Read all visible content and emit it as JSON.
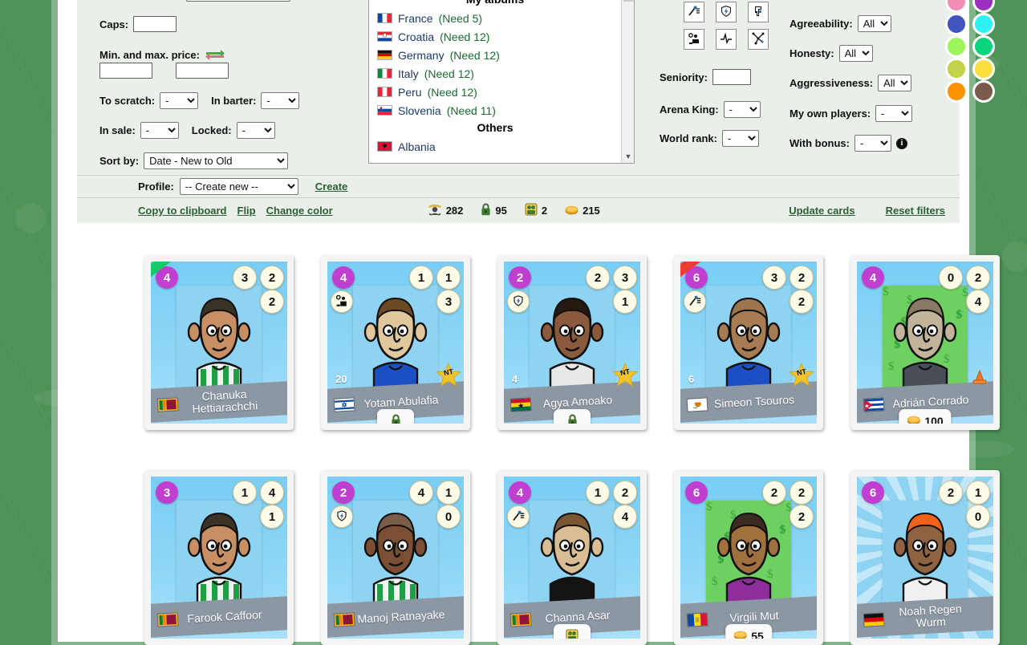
{
  "filters": {
    "caps_label": "Caps:",
    "caps_value": "",
    "price_label": "Min. and max. price:",
    "price_min": "",
    "price_max": "",
    "to_scratch_label": "To scratch:",
    "to_scratch_value": "-",
    "in_barter_label": "In barter:",
    "in_barter_value": "-",
    "in_sale_label": "In sale:",
    "in_sale_value": "-",
    "locked_label": "Locked:",
    "locked_value": "-",
    "sort_by_label": "Sort by:",
    "sort_by_value": "Date - New to Old",
    "seniority_label": "Seniority:",
    "seniority_value": "",
    "arena_king_label": "Arena King:",
    "arena_king_value": "-",
    "world_rank_label": "World rank:",
    "world_rank_value": "-",
    "agreeability_label": "Agreeability:",
    "agreeability_value": "All",
    "honesty_label": "Honesty:",
    "honesty_value": "All",
    "aggressiveness_label": "Aggressiveness:",
    "aggressiveness_value": "All",
    "my_own_players_label": "My own players:",
    "my_own_players_value": "-",
    "with_bonus_label": "With bonus:",
    "with_bonus_value": "-",
    "info_glyph": "i"
  },
  "skill_buttons": [
    {
      "name": "shooting-icon"
    },
    {
      "name": "shield-lightning-icon"
    },
    {
      "name": "goalkeeper-glove-icon"
    },
    {
      "name": "defender-icon"
    },
    {
      "name": "stamina-pulse-icon"
    },
    {
      "name": "passing-network-icon"
    }
  ],
  "albums": {
    "my_albums_header": "My albums",
    "others_header": "Others",
    "my_items": [
      {
        "country": "France",
        "need": "(Need 5)",
        "flag": "france"
      },
      {
        "country": "Croatia",
        "need": "(Need 12)",
        "flag": "croatia"
      },
      {
        "country": "Germany",
        "need": "(Need 12)",
        "flag": "germany"
      },
      {
        "country": "Italy",
        "need": "(Need 12)",
        "flag": "italy"
      },
      {
        "country": "Peru",
        "need": "(Need 12)",
        "flag": "peru"
      },
      {
        "country": "Slovenia",
        "need": "(Need 11)",
        "flag": "slovenia"
      }
    ],
    "other_items": [
      {
        "country": "Albania",
        "need": "",
        "flag": "albania"
      }
    ]
  },
  "colors": {
    "swatches": [
      "#f28cb4",
      "#9b2fc0",
      "#4154c0",
      "#2ef2f2",
      "#9cf55a",
      "#0ad47e",
      "#c2d249",
      "#fbdf3c",
      "#ff9200",
      "#7a5a4b"
    ],
    "accent_link": "#2a6033",
    "panel_bg": "#eaefea",
    "page_bg": "#4f9259",
    "level_badge": "#c13fd0",
    "nameplate": "#8c97a4"
  },
  "profile_row": {
    "label": "Profile:",
    "value": "-- Create new --",
    "create_link": "Create"
  },
  "toolbar": {
    "copy_to_clipboard": "Copy to clipboard",
    "flip": "Flip",
    "change_color": "Change color",
    "update_cards": "Update cards",
    "reset_filters": "Reset filters",
    "counts": [
      {
        "icon": "player-icon",
        "value": "282"
      },
      {
        "icon": "lock-icon",
        "value": "95"
      },
      {
        "icon": "duplicate-icon",
        "value": "2"
      },
      {
        "icon": "coin-icon",
        "value": "215"
      }
    ]
  },
  "cards": [
    {
      "name": "Chanuka Hettiarachchi",
      "level": "4",
      "stats": [
        "3",
        "2",
        "2"
      ],
      "flag": "srilanka",
      "role_icon": null,
      "seniority": null,
      "nt": false,
      "ribbon": "green",
      "pill": null,
      "money_bg": false,
      "rays": false,
      "shirt": "green-white-stripe",
      "hair": "#3a3226",
      "skin": "#c98f64"
    },
    {
      "name": "Yotam Abulafia",
      "level": "4",
      "stats": [
        "1",
        "1",
        "3"
      ],
      "flag": "israel",
      "role_icon": "defender-icon",
      "seniority": "20",
      "nt": true,
      "ribbon": null,
      "pill": {
        "icon": "lock-icon",
        "value": ""
      },
      "money_bg": false,
      "rays": false,
      "shirt": "blue",
      "hair": "#6b4a23",
      "skin": "#e0c79c"
    },
    {
      "name": "Agya Amoako",
      "level": "2",
      "stats": [
        "2",
        "3",
        "1"
      ],
      "flag": "ghana",
      "role_icon": "shield-lightning-icon",
      "seniority": "4",
      "nt": true,
      "ribbon": null,
      "pill": {
        "icon": "lock-icon",
        "value": ""
      },
      "money_bg": false,
      "rays": false,
      "shirt": "white-black",
      "hair": "#241a12",
      "skin": "#8b5a3c"
    },
    {
      "name": "Simeon Tsouros",
      "level": "6",
      "stats": [
        "3",
        "2",
        "2"
      ],
      "flag": "cyprus",
      "role_icon": "shooting-icon",
      "seniority": "6",
      "nt": true,
      "ribbon": "red",
      "pill": null,
      "money_bg": false,
      "rays": false,
      "shirt": "blue",
      "hair": "#9a7550",
      "skin": "#a87c52"
    },
    {
      "name": "Adrián Corrado",
      "level": "4",
      "stats": [
        "0",
        "2",
        "4"
      ],
      "flag": "cuba",
      "role_icon": null,
      "seniority": null,
      "nt": false,
      "ribbon": null,
      "pill": {
        "icon": "coin-icon",
        "value": "100"
      },
      "money_bg": true,
      "rays": false,
      "shirt": "dark",
      "hair": "#8b7a63",
      "skin": "#c2b49a"
    },
    {
      "name": "Farook Caffoor",
      "level": "3",
      "stats": [
        "1",
        "4",
        "1"
      ],
      "flag": "srilanka",
      "role_icon": null,
      "seniority": null,
      "nt": false,
      "ribbon": null,
      "pill": null,
      "money_bg": false,
      "rays": false,
      "shirt": "green-white-stripe",
      "hair": "#3b3328",
      "skin": "#c98f64"
    },
    {
      "name": "Manoj Ratnayake",
      "level": "2",
      "stats": [
        "4",
        "1",
        "0"
      ],
      "flag": "srilanka",
      "role_icon": "shield-lightning-icon",
      "seniority": null,
      "nt": false,
      "ribbon": null,
      "pill": null,
      "money_bg": false,
      "rays": false,
      "shirt": "green-white-stripe",
      "hair": "#7a5c4a",
      "skin": "#7a4f34"
    },
    {
      "name": "Channa Asar",
      "level": "4",
      "stats": [
        "1",
        "2",
        "4"
      ],
      "flag": "srilanka",
      "role_icon": "shooting-icon",
      "seniority": null,
      "nt": false,
      "ribbon": null,
      "pill": {
        "icon": "duplicate-icon",
        "value": ""
      },
      "money_bg": false,
      "rays": false,
      "shirt": "black",
      "hair": "#7a5632",
      "skin": "#d9bd95"
    },
    {
      "name": "Virgili Mut",
      "level": "6",
      "stats": [
        "2",
        "2",
        "2"
      ],
      "flag": "andorra",
      "role_icon": null,
      "seniority": null,
      "nt": false,
      "ribbon": null,
      "pill": {
        "icon": "coin-icon",
        "value": "55"
      },
      "money_bg": true,
      "rays": false,
      "shirt": "purple",
      "hair": "#3b2b20",
      "skin": "#a0713f"
    },
    {
      "name": "Noah Regen Wurm",
      "level": "6",
      "stats": [
        "2",
        "1",
        "0"
      ],
      "flag": "germany",
      "role_icon": null,
      "seniority": null,
      "nt": false,
      "ribbon": null,
      "pill": null,
      "money_bg": false,
      "rays": true,
      "shirt": "white",
      "hair": "#f0621a",
      "skin": "#8f6242"
    }
  ]
}
